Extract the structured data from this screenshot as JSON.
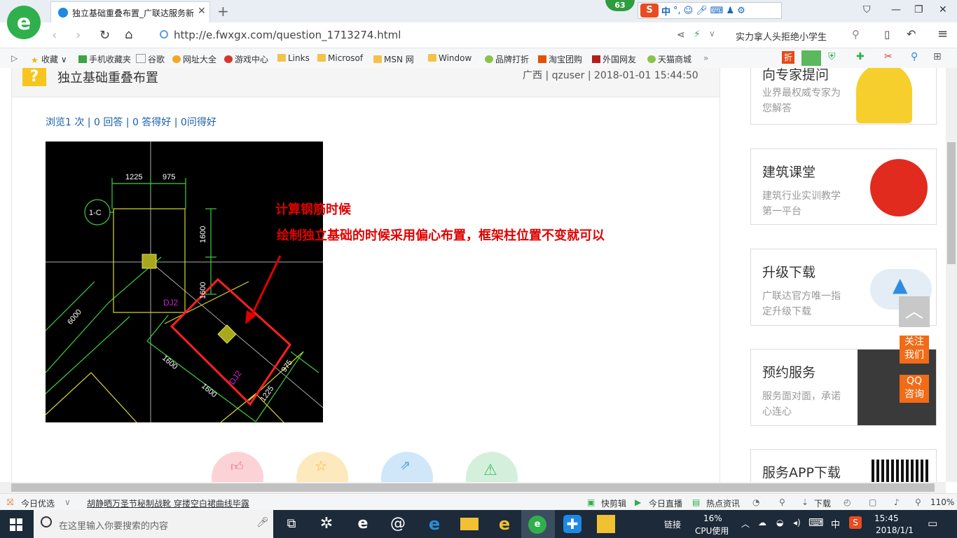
{
  "browser": {
    "tab_title": "独立基础重叠布置_广联达服务新",
    "url": "http://e.fwxgx.com/question_1713274.html",
    "search_text": "实力拿人头拒绝小学生",
    "badge": "63",
    "ime_label": "中"
  },
  "bookmarks": [
    {
      "label": "收藏"
    },
    {
      "label": "手机收藏夹"
    },
    {
      "label": "谷歌"
    },
    {
      "label": "网址大全"
    },
    {
      "label": "游戏中心"
    },
    {
      "label": "Links"
    },
    {
      "label": "Microsof"
    },
    {
      "label": "MSN 网"
    },
    {
      "label": "Window"
    },
    {
      "label": "品牌打折"
    },
    {
      "label": "淘宝团购"
    },
    {
      "label": "外国网友"
    },
    {
      "label": "天猫商城"
    }
  ],
  "question": {
    "title": "独立基础重叠布置",
    "meta": "广西 | qzuser | 2018-01-01 15:44:50",
    "stats": "浏览1 次 | 0 回答 | 0 答得好 | 0问得好"
  },
  "cad": {
    "dim_1225_top": "1225",
    "dim_975_top": "975",
    "axis": "1-C",
    "dim_1600_v": "1600",
    "dim_1600_v2": "1600",
    "label_dj": "DJ2",
    "dim_6000": "6000",
    "dim_1600_a": "1600",
    "dim_1600_b": "1600",
    "dim_975_r": "975",
    "dim_1225_r": "1225",
    "label_dj2": "DJ2"
  },
  "annotation": {
    "line1": "计算钢筋时候",
    "line2": "绘制独立基础的时候采用偏心布置，框架柱位置不变就可以"
  },
  "sidebar": {
    "cards": [
      {
        "title": "向专家提问",
        "sub": "业界最权威专家为您解答"
      },
      {
        "title": "建筑课堂",
        "sub": "建筑行业实训教学第一平台"
      },
      {
        "title": "升级下载",
        "sub": "广联达官方唯一指定升级下载"
      },
      {
        "title": "预约服务",
        "sub": "服务面对面，承诺心连心"
      },
      {
        "title": "服务APP下载",
        "sub": ""
      }
    ],
    "follow": "关注我们",
    "qq": "QQ咨询"
  },
  "statusbar": {
    "today": "今日优选",
    "headline": "胡静晒万圣节秘制战靴 穿搂空白裙曲线毕露",
    "quick_cut": "快剪辑",
    "live": "今日直播",
    "news": "热点资讯",
    "download": "下载",
    "zoom": "110%"
  },
  "taskbar": {
    "search_placeholder": "在这里输入你要搜索的内容",
    "link": "链接",
    "cpu_pct": "16%",
    "cpu_label": "CPU使用",
    "ime": "中",
    "time": "15:45",
    "date": "2018/1/1"
  },
  "colors": {
    "accent": "#1a5fa8",
    "annotation": "#e00000",
    "orange": "#f26b17"
  }
}
